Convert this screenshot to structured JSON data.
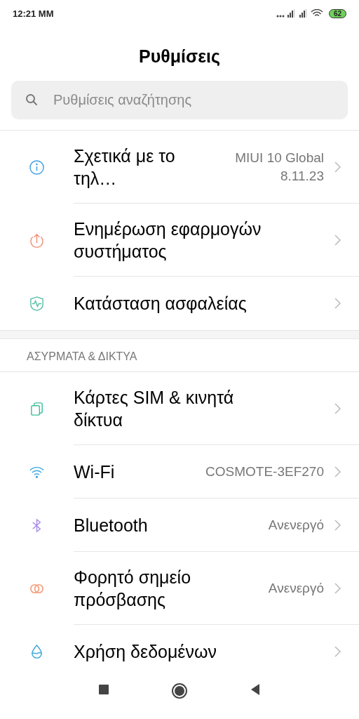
{
  "status_bar": {
    "time": "12:21 ΜΜ",
    "battery": "62"
  },
  "title": "Ρυθμίσεις",
  "search": {
    "placeholder": "Ρυθμίσεις αναζήτησης"
  },
  "sections": [
    {
      "items": [
        {
          "kind": "info",
          "title": "Σχετικά με το τηλ…",
          "value": "MIUI 10 Global 8.11.23"
        },
        {
          "kind": "update",
          "title": "Ενημέρωση εφαρμογών συστήματος"
        },
        {
          "kind": "shield",
          "title": "Κατάσταση ασφαλείας"
        }
      ]
    },
    {
      "header": "ΑΣΥΡΜΑΤΑ & ΔΙΚΤΥΑ",
      "items": [
        {
          "kind": "sim",
          "title": "Κάρτες SIM & κινητά δίκτυα"
        },
        {
          "kind": "wifi",
          "title": "Wi-Fi",
          "value": "COSMOTE-3EF270"
        },
        {
          "kind": "bluetooth",
          "title": "Bluetooth",
          "value": "Ανενεργό"
        },
        {
          "kind": "hotspot",
          "title": "Φορητό σημείο πρόσβασης",
          "value": "Ανενεργό"
        },
        {
          "kind": "data",
          "title": "Χρήση δεδομένων"
        }
      ]
    }
  ]
}
